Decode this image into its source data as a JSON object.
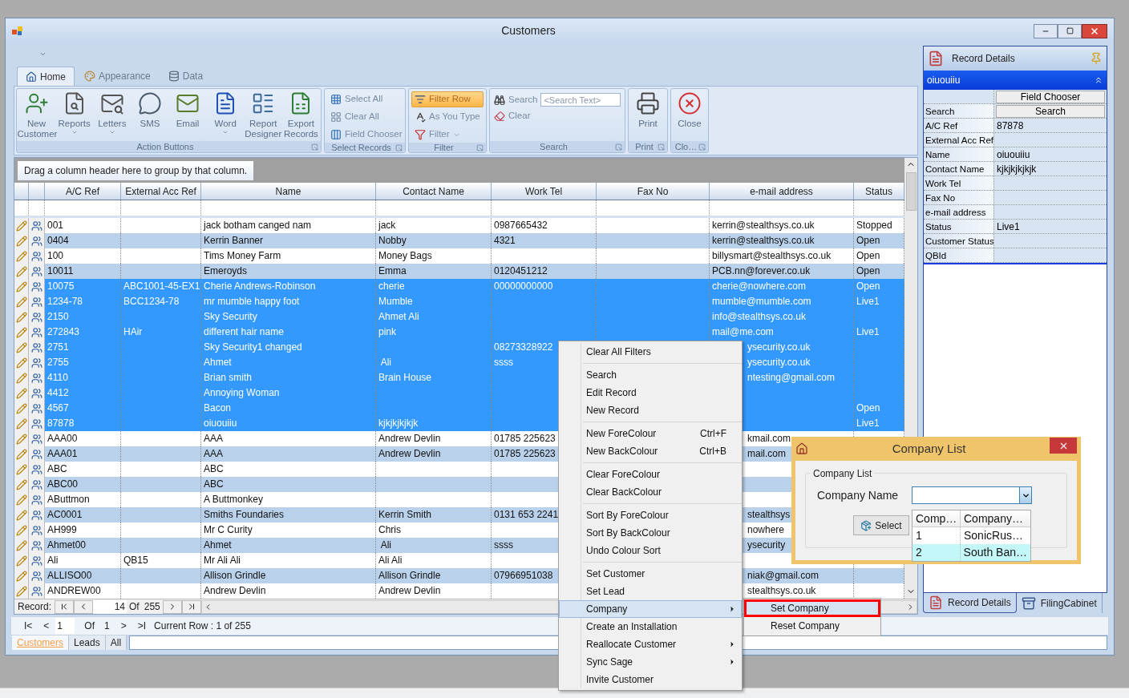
{
  "window": {
    "title": "Customers"
  },
  "ribbon": {
    "tabs": [
      {
        "label": "Home",
        "selected": true
      },
      {
        "label": "Appearance",
        "selected": false
      },
      {
        "label": "Data",
        "selected": false
      }
    ],
    "groups": [
      {
        "kind": "large",
        "title": "Action Buttons",
        "items": [
          {
            "label": "New Customer",
            "dropdown": false
          },
          {
            "label": "Reports",
            "dropdown": true
          },
          {
            "label": "Letters",
            "dropdown": true
          },
          {
            "label": "SMS",
            "dropdown": false
          },
          {
            "label": "Email",
            "dropdown": false
          },
          {
            "label": "Word",
            "dropdown": true
          },
          {
            "label": "Report Designer",
            "dropdown": false
          },
          {
            "label": "Export Records",
            "dropdown": false
          }
        ]
      },
      {
        "kind": "small",
        "title": "Select Records",
        "items": [
          {
            "label": "Select All",
            "active": false,
            "dropdown": false
          },
          {
            "label": "Clear All",
            "active": false,
            "dropdown": false
          },
          {
            "label": "Field Chooser",
            "active": false,
            "dropdown": false
          }
        ]
      },
      {
        "kind": "small",
        "title": "Filter",
        "items": [
          {
            "label": "Filter Row",
            "active": true,
            "dropdown": false
          },
          {
            "label": "As You Type",
            "active": false,
            "dropdown": false
          },
          {
            "label": "Filter",
            "active": false,
            "dropdown": true
          }
        ]
      },
      {
        "kind": "search",
        "title": "Search",
        "items": [
          {
            "label": "Search",
            "placeholder": "<Search Text>"
          },
          {
            "label": "Clear"
          }
        ]
      },
      {
        "kind": "large",
        "title": "Print",
        "items": [
          {
            "label": "Print",
            "dropdown": false
          }
        ]
      },
      {
        "kind": "large",
        "title": "Clo…",
        "items": [
          {
            "label": "Close",
            "dropdown": false
          }
        ]
      }
    ]
  },
  "grid": {
    "group_hint": "Drag a column header here to group by that column.",
    "columns": [
      "A/C Ref",
      "External Acc Ref",
      "Name",
      "Contact Name",
      "Work Tel",
      "Fax No",
      "e-mail address",
      "Status"
    ],
    "rows": [
      {
        "ac_ref": "001",
        "name": "jack botham canged nam",
        "contact_name": "jack",
        "work_tel": "0987665432",
        "email": "kerrin@stealthsys.co.uk",
        "status": "Stopped",
        "selected": false,
        "email_under_menu": false
      },
      {
        "ac_ref": "0404",
        "name": "Kerrin Banner",
        "contact_name": "Nobby",
        "work_tel": "4321",
        "email": "kerrin@stealthsys.co.uk",
        "status": "Open",
        "selected": false,
        "email_under_menu": false
      },
      {
        "ac_ref": "100",
        "name": "Tims Money Farm",
        "contact_name": "Money Bags",
        "email": "billysmart@stealthsys.co.uk",
        "status": "Open",
        "selected": false,
        "email_under_menu": false
      },
      {
        "ac_ref": "10011",
        "name": "Emeroyds",
        "contact_name": "Emma",
        "work_tel": "0120451212",
        "email": "PCB.nn@forever.co.uk",
        "status": "Open",
        "selected": false,
        "email_under_menu": false
      },
      {
        "ac_ref": "10075",
        "external_acc_ref": "ABC1001-45-EX1",
        "name": "Cherie Andrews-Robinson",
        "contact_name": "cherie",
        "work_tel": "00000000000",
        "email": "cherie@nowhere.com",
        "status": "Open",
        "selected": true,
        "email_under_menu": false
      },
      {
        "ac_ref": "1234-78",
        "external_acc_ref": "BCC1234-78",
        "name": "mr mumble happy foot",
        "contact_name": "Mumble",
        "email": "mumble@mumble.com",
        "status": "Live1",
        "selected": true,
        "email_under_menu": false
      },
      {
        "ac_ref": "2150",
        "name": "Sky Security",
        "contact_name": "Ahmet Ali",
        "email": "info@stealthsys.co.uk",
        "selected": true,
        "email_under_menu": false
      },
      {
        "ac_ref": "272843",
        "external_acc_ref": "HAir",
        "name": "different hair name",
        "contact_name": "pink",
        "email": "mail@me.com",
        "status": "Live1",
        "selected": true,
        "email_under_menu": false
      },
      {
        "ac_ref": "2751",
        "name": "Sky Security1 changed",
        "work_tel": "08273328922",
        "email": "ysecurity.co.uk",
        "selected": true,
        "email_under_menu": true
      },
      {
        "ac_ref": "2755",
        "name": "Ahmet",
        "contact_name": " Ali",
        "work_tel": "ssss",
        "email": "ysecurity.co.uk",
        "selected": true,
        "email_under_menu": true
      },
      {
        "ac_ref": "4110",
        "name": "Brian smith",
        "contact_name": "Brain House",
        "email": "ntesting@gmail.com",
        "selected": true,
        "email_under_menu": true
      },
      {
        "ac_ref": "4412",
        "name": "Annoying Woman",
        "selected": true
      },
      {
        "ac_ref": "4567",
        "name": "Bacon",
        "status": "Open",
        "selected": true
      },
      {
        "ac_ref": "87878",
        "name": "oiuouiiu",
        "contact_name": "kjkjkjkjkjk",
        "status": "Live1",
        "selected": true
      },
      {
        "ac_ref": "AAA00",
        "name": "AAA",
        "contact_name": "Andrew Devlin",
        "work_tel": "01785 225623",
        "email": "kmail.com",
        "selected": false,
        "email_under_menu": true
      },
      {
        "ac_ref": "AAA01",
        "name": "AAA",
        "contact_name": "Andrew Devlin",
        "work_tel": "01785 225623",
        "email": "mail.com",
        "selected": false,
        "email_under_menu": true
      },
      {
        "ac_ref": "ABC",
        "name": "ABC",
        "selected": false
      },
      {
        "ac_ref": "ABC00",
        "name": "ABC",
        "selected": false
      },
      {
        "ac_ref": "AButtmon",
        "name": "A Buttmonkey",
        "selected": false
      },
      {
        "ac_ref": "AC0001",
        "name": "Smiths Foundaries",
        "contact_name": "Kerrin Smith",
        "work_tel": "0131 653 2241",
        "email": "stealthsys",
        "selected": false,
        "email_under_menu": true
      },
      {
        "ac_ref": "AH999",
        "name": "Mr C Curity",
        "contact_name": "Chris",
        "email": "nowhere",
        "selected": false,
        "email_under_menu": true
      },
      {
        "ac_ref": "Ahmet00",
        "name": "Ahmet",
        "contact_name": " Ali",
        "work_tel": "ssss",
        "email": "ysecurity",
        "selected": false,
        "email_under_menu": true
      },
      {
        "ac_ref": "Ali",
        "external_acc_ref": "QB15",
        "name": "Mr Ali Ali",
        "contact_name": "Ali Ali",
        "selected": false
      },
      {
        "ac_ref": "ALLISO00",
        "name": "Allison Grindle",
        "contact_name": "Allison Grindle",
        "work_tel": "07966951038",
        "email": "niak@gmail.com",
        "selected": false,
        "email_under_menu": true
      },
      {
        "ac_ref": "ANDREW00",
        "name": "Andrew Devlin",
        "contact_name": "Andrew Devlin",
        "email": "stealthsys.co.uk",
        "selected": false,
        "email_under_menu": true
      }
    ],
    "navigator": {
      "label": "Record:",
      "current": "14",
      "of": "Of",
      "total": "255"
    }
  },
  "pager": {
    "first": "I<",
    "prev": "<",
    "page": "1",
    "of": "Of",
    "pages": "1",
    "next": ">",
    "last": ">I",
    "status": "Current Row : 1 of 255"
  },
  "bottom_tabs": [
    {
      "label": "Customers",
      "selected": true
    },
    {
      "label": "Leads",
      "selected": false
    },
    {
      "label": "All",
      "selected": false
    }
  ],
  "record_panel": {
    "title": "Record Details",
    "record": "oiuouiiu",
    "fields": [
      {
        "kind": "button",
        "value": "Field Chooser"
      },
      {
        "kind": "button",
        "label": "Search",
        "value": "Search"
      },
      {
        "kind": "text",
        "label": "A/C Ref",
        "value": "87878"
      },
      {
        "kind": "text",
        "label": "External Acc Ref"
      },
      {
        "kind": "text",
        "label": "Name",
        "value": "oiuouiiu"
      },
      {
        "kind": "text",
        "label": "Contact Name",
        "value": "kjkjkjkjkjk"
      },
      {
        "kind": "text",
        "label": "Work Tel"
      },
      {
        "kind": "text",
        "label": "Fax No"
      },
      {
        "kind": "text",
        "label": "e-mail address"
      },
      {
        "kind": "text",
        "label": "Status",
        "value": "Live1"
      },
      {
        "kind": "text",
        "label": "Customer Status"
      },
      {
        "kind": "text",
        "label": "QBId"
      }
    ],
    "tabs": [
      {
        "label": "Record Details",
        "selected": true
      },
      {
        "label": "FilingCabinet",
        "selected": false
      }
    ]
  },
  "context_menu": {
    "groups": [
      [
        {
          "label": "Clear All Filters",
          "selected": false,
          "submenu": false
        }
      ],
      [
        {
          "label": "Search",
          "selected": false,
          "submenu": false
        },
        {
          "label": "Edit Record",
          "selected": false,
          "submenu": false
        },
        {
          "label": "New Record",
          "selected": false,
          "submenu": false
        }
      ],
      [
        {
          "label": "New ForeColour",
          "shortcut": "Ctrl+F",
          "selected": false,
          "submenu": false
        },
        {
          "label": "New BackColour",
          "shortcut": "Ctrl+B",
          "selected": false,
          "submenu": false
        }
      ],
      [
        {
          "label": "Clear ForeColour",
          "selected": false,
          "submenu": false
        },
        {
          "label": "Clear BackColour",
          "selected": false,
          "submenu": false
        }
      ],
      [
        {
          "label": "Sort By ForeColour",
          "selected": false,
          "submenu": false
        },
        {
          "label": "Sort By BackColour",
          "selected": false,
          "submenu": false
        },
        {
          "label": "Undo Colour Sort",
          "selected": false,
          "submenu": false
        }
      ],
      [
        {
          "label": "Set Customer",
          "selected": false,
          "submenu": false
        },
        {
          "label": "Set Lead",
          "selected": false,
          "submenu": false
        },
        {
          "label": "Company",
          "selected": true,
          "submenu": true
        },
        {
          "label": "Create an Installation",
          "selected": false,
          "submenu": false
        },
        {
          "label": "Reallocate Customer",
          "selected": false,
          "submenu": true
        },
        {
          "label": "Sync Sage",
          "selected": false,
          "submenu": true
        },
        {
          "label": "Invite Customer",
          "selected": false,
          "submenu": false
        }
      ]
    ],
    "submenu": [
      {
        "label": "Set Company",
        "selected": true,
        "highlighted": true
      },
      {
        "label": "Reset Company",
        "selected": false,
        "highlighted": false
      }
    ]
  },
  "dialog": {
    "title": "Company List",
    "group_title": "Company List",
    "field_label": "Company Name",
    "button": "Select",
    "list": {
      "columns": [
        "Comp…",
        "Company…"
      ],
      "rows": [
        {
          "cells": [
            "1",
            "SonicRus…"
          ],
          "selected": false
        },
        {
          "cells": [
            "2",
            "South Ban…"
          ],
          "selected": true
        }
      ]
    }
  }
}
